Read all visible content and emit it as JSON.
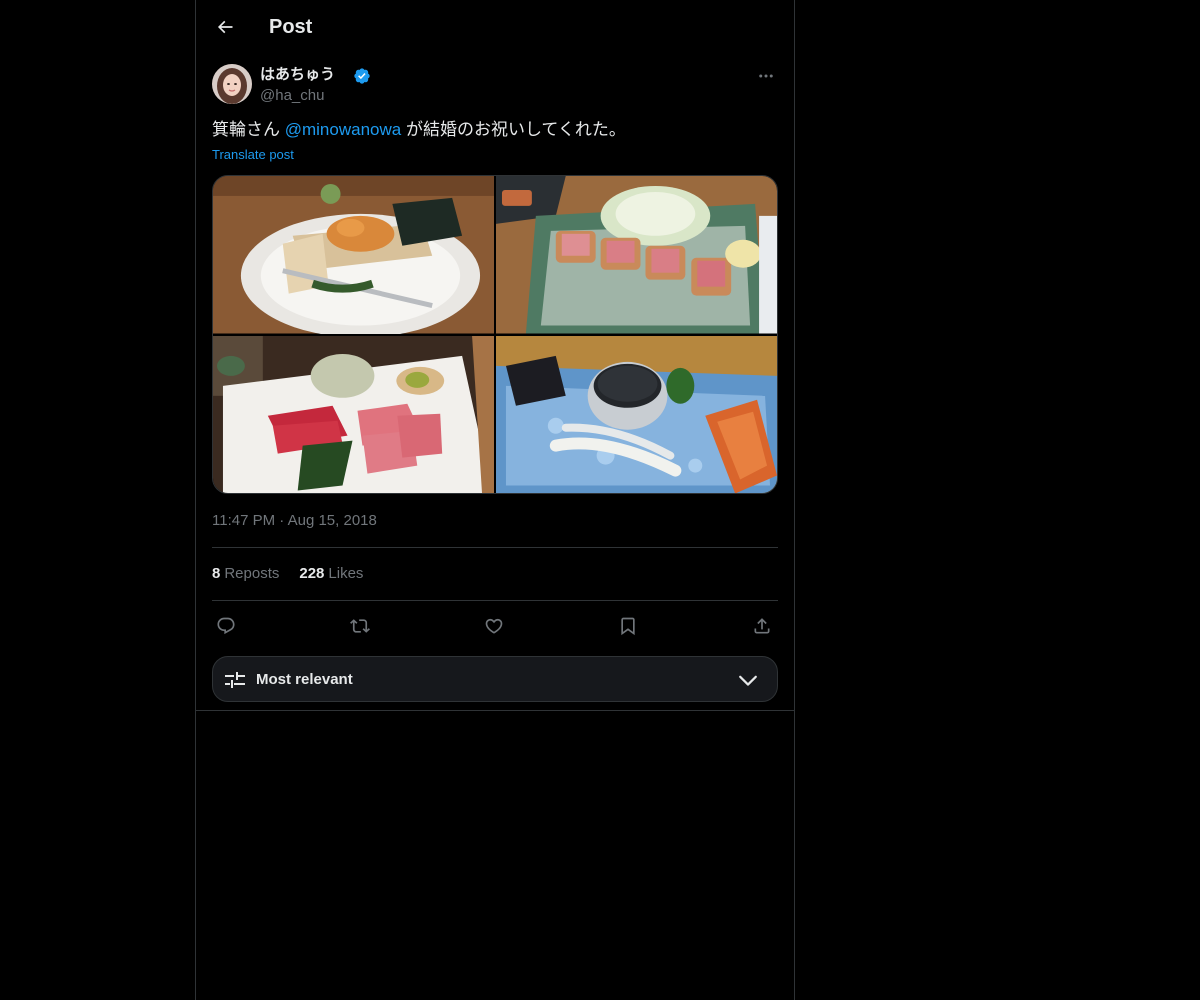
{
  "header": {
    "title": "Post",
    "back_icon": "arrow-left-icon"
  },
  "post": {
    "author": {
      "display_name": "はあちゅう",
      "handle": "@ha_chu",
      "verified": true,
      "verified_color": "#1d9bf0"
    },
    "text_before": "箕輪さん ",
    "mention": "@minowanowa",
    "text_after": " が結婚のお祝いしてくれた。",
    "translate_label": "Translate post",
    "media": [
      {
        "description": "uni on wooden box with nori on white plate"
      },
      {
        "description": "tuna katsu with shredded cabbage on wire rack"
      },
      {
        "description": "tuna sashimi with shiso and wasabi"
      },
      {
        "description": "caviar tin with mother-of-pearl spoons on blue plate"
      }
    ],
    "time": "11:47 PM",
    "date": "Aug 15, 2018",
    "separator": "·",
    "reposts_count": "8",
    "reposts_label": "Reposts",
    "likes_count": "228",
    "likes_label": "Likes"
  },
  "actions": {
    "icons": [
      "reply-icon",
      "repost-icon",
      "like-icon",
      "bookmark-icon",
      "share-icon"
    ]
  },
  "sort": {
    "label": "Most relevant",
    "icon": "sliders-icon",
    "chevron": "chevron-down-icon"
  },
  "colors": {
    "background": "#000000",
    "text": "#e7e9ea",
    "muted": "#71767b",
    "link": "#1d9bf0",
    "border": "#2f3336"
  }
}
